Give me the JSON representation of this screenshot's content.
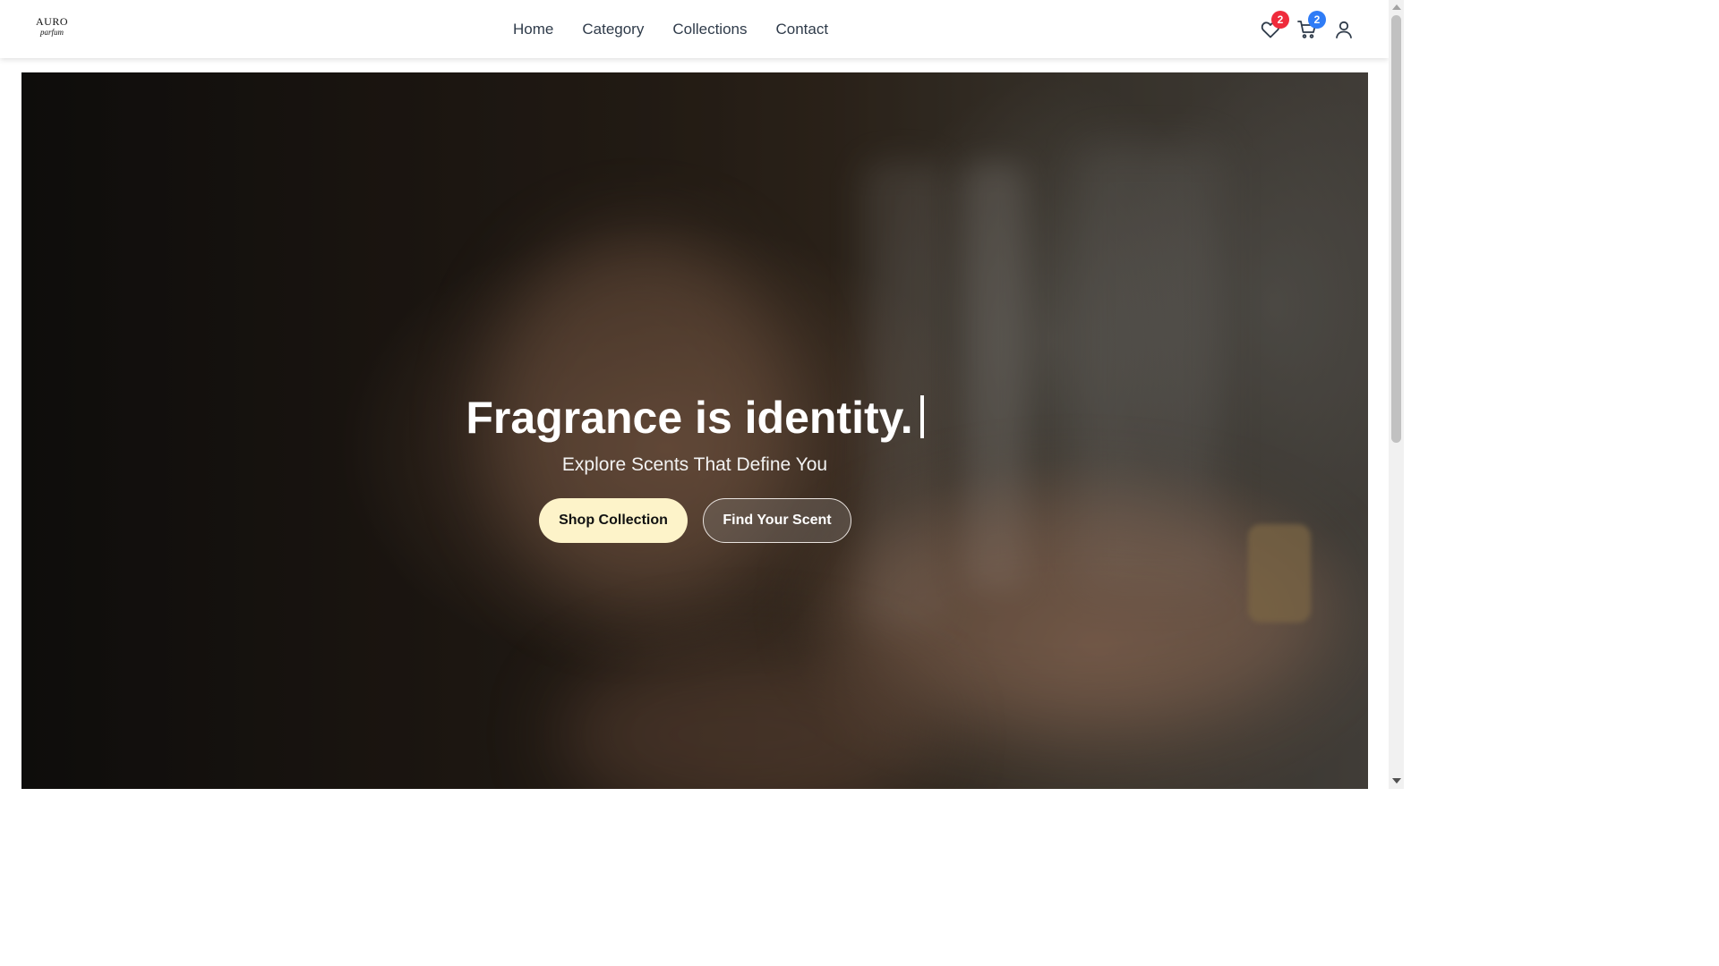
{
  "brand": {
    "logo_top": "AURO",
    "logo_bottom": "parfum"
  },
  "nav": {
    "items": [
      {
        "label": "Home"
      },
      {
        "label": "Category"
      },
      {
        "label": "Collections"
      },
      {
        "label": "Contact"
      }
    ]
  },
  "header_icons": {
    "wishlist": {
      "icon": "heart-icon",
      "badge": "2",
      "badge_color": "#ef2b3b"
    },
    "cart": {
      "icon": "cart-icon",
      "badge": "2",
      "badge_color": "#2f7cf6"
    },
    "account": {
      "icon": "user-icon"
    }
  },
  "hero": {
    "title": "Fragrance is identity.",
    "subtitle": "Explore Scents That Define You",
    "primary_button": "Shop Collection",
    "secondary_button": "Find Your Scent"
  },
  "colors": {
    "primary_button_bg": "#fdf3c9",
    "nav_text": "#2f3b4a"
  }
}
